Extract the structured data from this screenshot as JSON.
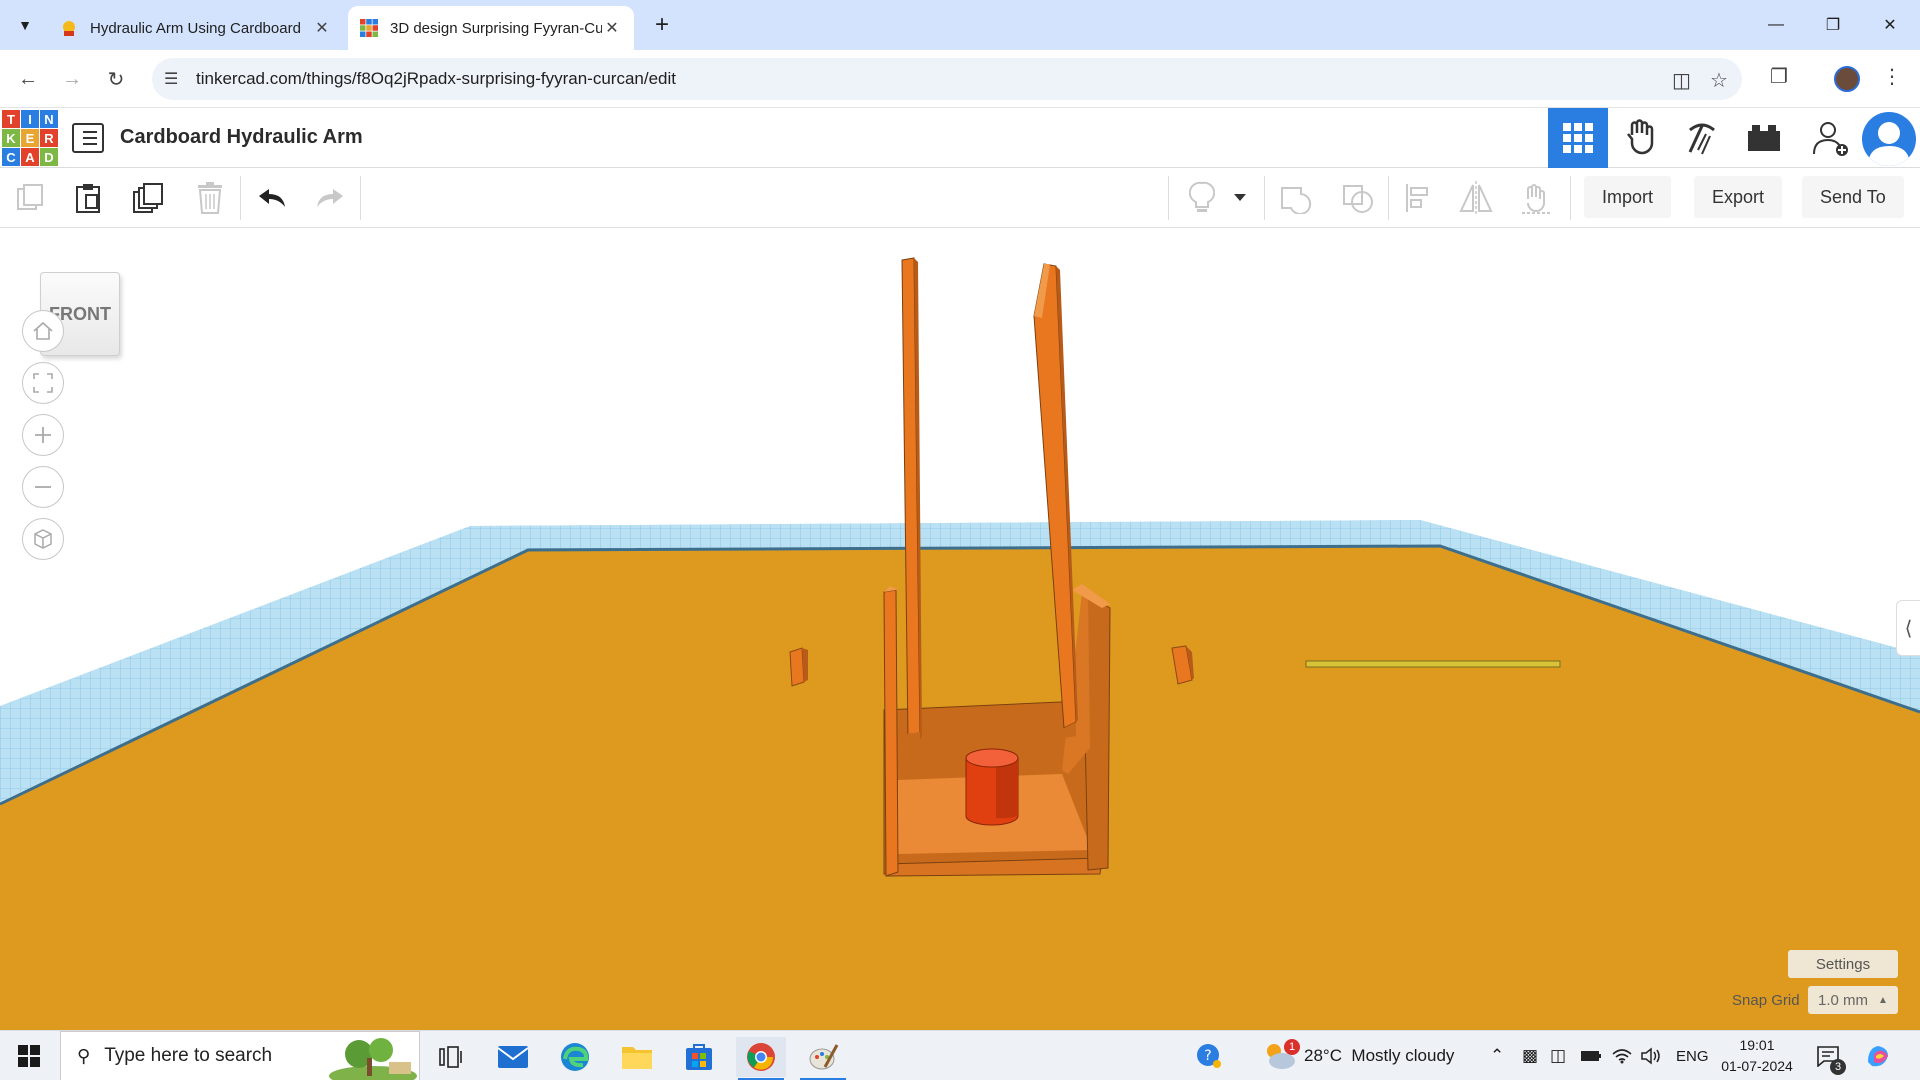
{
  "browser": {
    "tabs": [
      {
        "title": "Hydraulic Arm Using Cardboard",
        "active": false
      },
      {
        "title": "3D design Surprising Fyyran-Cu",
        "active": true
      }
    ],
    "url": "tinkercad.com/things/f8Oq2jRpadx-surprising-fyyran-curcan/edit"
  },
  "app": {
    "logo_letters": [
      "T",
      "I",
      "N",
      "K",
      "E",
      "R",
      "C",
      "A",
      "D"
    ],
    "design_title": "Cardboard Hydraulic Arm"
  },
  "toolbar": {
    "import_label": "Import",
    "export_label": "Export",
    "send_to_label": "Send To"
  },
  "workplane": {
    "viewcube_label": "FRONT",
    "settings_label": "Settings",
    "snap_grid_label": "Snap Grid",
    "snap_grid_value": "1.0 mm"
  },
  "taskbar": {
    "search_placeholder": "Type here to search",
    "weather": "28°C  Mostly cloudy",
    "language": "ENG",
    "time": "19:01",
    "date": "01-07-2024",
    "notification_count": "3",
    "weather_alert": "1"
  },
  "colors": {
    "tinkercad_blue": "#2a7de1",
    "grid_blue": "#a9d8f0",
    "plane_orange": "#de9a1f",
    "shape_orange": "#e8771f",
    "cylinder_red": "#e8390e",
    "rod_yellow": "#d8c336"
  }
}
